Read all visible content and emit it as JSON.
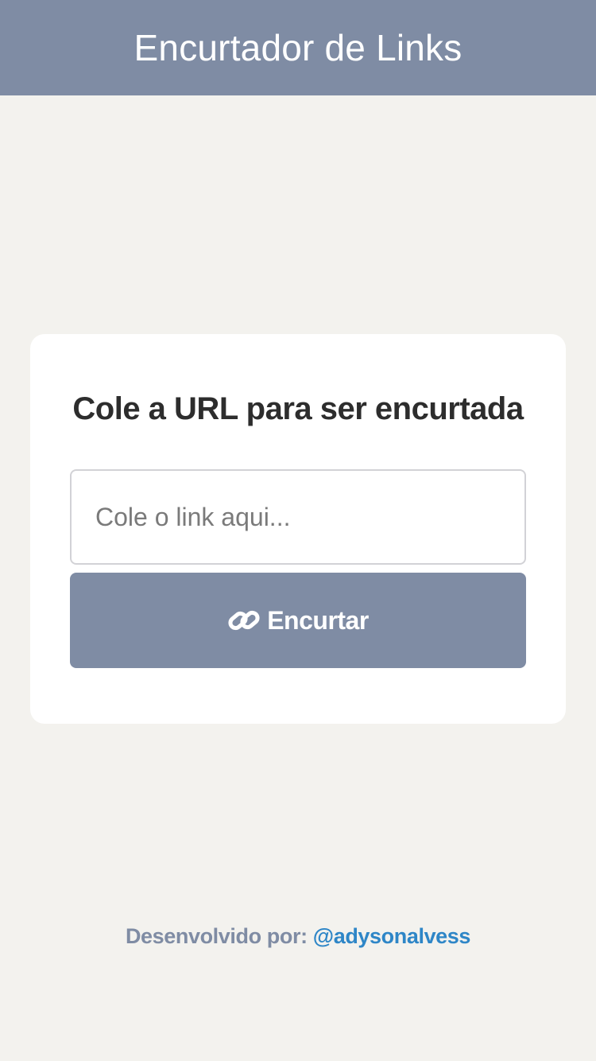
{
  "header": {
    "title": "Encurtador de Links"
  },
  "form": {
    "title": "Cole a URL para ser encurtada",
    "input_placeholder": "Cole o link aqui...",
    "input_value": "",
    "button_label": "Encurtar",
    "button_icon": "link-icon"
  },
  "footer": {
    "prefix": "Desenvolvido por:",
    "author_link": "@adysonalvess"
  },
  "colors": {
    "header_bg": "#7f8ca4",
    "page_bg": "#f3f2ee",
    "button_bg": "#7f8ca4",
    "link": "#2e86c7"
  }
}
